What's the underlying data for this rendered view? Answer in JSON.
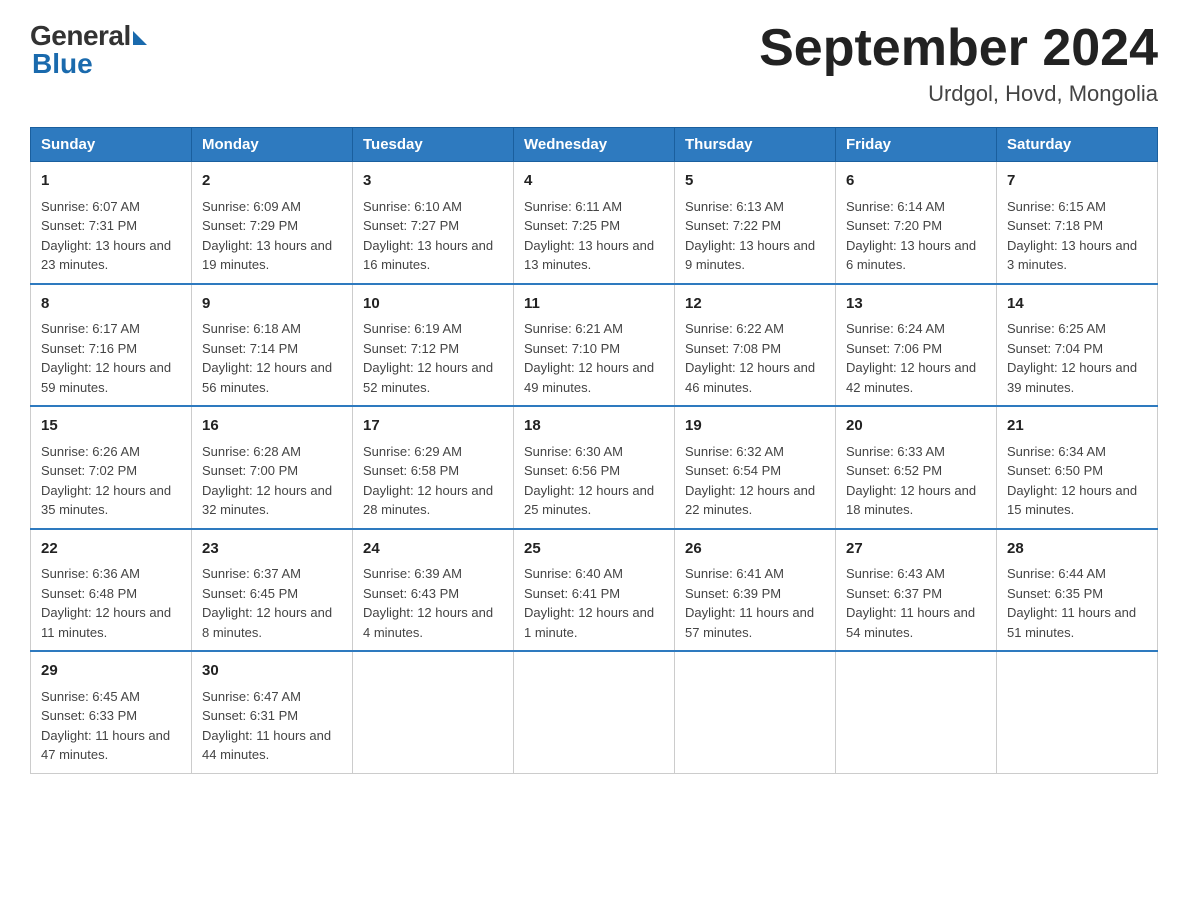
{
  "header": {
    "logo_general": "General",
    "logo_blue": "Blue",
    "title": "September 2024",
    "location": "Urdgol, Hovd, Mongolia"
  },
  "days_of_week": [
    "Sunday",
    "Monday",
    "Tuesday",
    "Wednesday",
    "Thursday",
    "Friday",
    "Saturday"
  ],
  "weeks": [
    [
      {
        "day": "1",
        "sunrise": "6:07 AM",
        "sunset": "7:31 PM",
        "daylight": "13 hours and 23 minutes."
      },
      {
        "day": "2",
        "sunrise": "6:09 AM",
        "sunset": "7:29 PM",
        "daylight": "13 hours and 19 minutes."
      },
      {
        "day": "3",
        "sunrise": "6:10 AM",
        "sunset": "7:27 PM",
        "daylight": "13 hours and 16 minutes."
      },
      {
        "day": "4",
        "sunrise": "6:11 AM",
        "sunset": "7:25 PM",
        "daylight": "13 hours and 13 minutes."
      },
      {
        "day": "5",
        "sunrise": "6:13 AM",
        "sunset": "7:22 PM",
        "daylight": "13 hours and 9 minutes."
      },
      {
        "day": "6",
        "sunrise": "6:14 AM",
        "sunset": "7:20 PM",
        "daylight": "13 hours and 6 minutes."
      },
      {
        "day": "7",
        "sunrise": "6:15 AM",
        "sunset": "7:18 PM",
        "daylight": "13 hours and 3 minutes."
      }
    ],
    [
      {
        "day": "8",
        "sunrise": "6:17 AM",
        "sunset": "7:16 PM",
        "daylight": "12 hours and 59 minutes."
      },
      {
        "day": "9",
        "sunrise": "6:18 AM",
        "sunset": "7:14 PM",
        "daylight": "12 hours and 56 minutes."
      },
      {
        "day": "10",
        "sunrise": "6:19 AM",
        "sunset": "7:12 PM",
        "daylight": "12 hours and 52 minutes."
      },
      {
        "day": "11",
        "sunrise": "6:21 AM",
        "sunset": "7:10 PM",
        "daylight": "12 hours and 49 minutes."
      },
      {
        "day": "12",
        "sunrise": "6:22 AM",
        "sunset": "7:08 PM",
        "daylight": "12 hours and 46 minutes."
      },
      {
        "day": "13",
        "sunrise": "6:24 AM",
        "sunset": "7:06 PM",
        "daylight": "12 hours and 42 minutes."
      },
      {
        "day": "14",
        "sunrise": "6:25 AM",
        "sunset": "7:04 PM",
        "daylight": "12 hours and 39 minutes."
      }
    ],
    [
      {
        "day": "15",
        "sunrise": "6:26 AM",
        "sunset": "7:02 PM",
        "daylight": "12 hours and 35 minutes."
      },
      {
        "day": "16",
        "sunrise": "6:28 AM",
        "sunset": "7:00 PM",
        "daylight": "12 hours and 32 minutes."
      },
      {
        "day": "17",
        "sunrise": "6:29 AM",
        "sunset": "6:58 PM",
        "daylight": "12 hours and 28 minutes."
      },
      {
        "day": "18",
        "sunrise": "6:30 AM",
        "sunset": "6:56 PM",
        "daylight": "12 hours and 25 minutes."
      },
      {
        "day": "19",
        "sunrise": "6:32 AM",
        "sunset": "6:54 PM",
        "daylight": "12 hours and 22 minutes."
      },
      {
        "day": "20",
        "sunrise": "6:33 AM",
        "sunset": "6:52 PM",
        "daylight": "12 hours and 18 minutes."
      },
      {
        "day": "21",
        "sunrise": "6:34 AM",
        "sunset": "6:50 PM",
        "daylight": "12 hours and 15 minutes."
      }
    ],
    [
      {
        "day": "22",
        "sunrise": "6:36 AM",
        "sunset": "6:48 PM",
        "daylight": "12 hours and 11 minutes."
      },
      {
        "day": "23",
        "sunrise": "6:37 AM",
        "sunset": "6:45 PM",
        "daylight": "12 hours and 8 minutes."
      },
      {
        "day": "24",
        "sunrise": "6:39 AM",
        "sunset": "6:43 PM",
        "daylight": "12 hours and 4 minutes."
      },
      {
        "day": "25",
        "sunrise": "6:40 AM",
        "sunset": "6:41 PM",
        "daylight": "12 hours and 1 minute."
      },
      {
        "day": "26",
        "sunrise": "6:41 AM",
        "sunset": "6:39 PM",
        "daylight": "11 hours and 57 minutes."
      },
      {
        "day": "27",
        "sunrise": "6:43 AM",
        "sunset": "6:37 PM",
        "daylight": "11 hours and 54 minutes."
      },
      {
        "day": "28",
        "sunrise": "6:44 AM",
        "sunset": "6:35 PM",
        "daylight": "11 hours and 51 minutes."
      }
    ],
    [
      {
        "day": "29",
        "sunrise": "6:45 AM",
        "sunset": "6:33 PM",
        "daylight": "11 hours and 47 minutes."
      },
      {
        "day": "30",
        "sunrise": "6:47 AM",
        "sunset": "6:31 PM",
        "daylight": "11 hours and 44 minutes."
      },
      null,
      null,
      null,
      null,
      null
    ]
  ],
  "labels": {
    "sunrise": "Sunrise:",
    "sunset": "Sunset:",
    "daylight": "Daylight:"
  }
}
